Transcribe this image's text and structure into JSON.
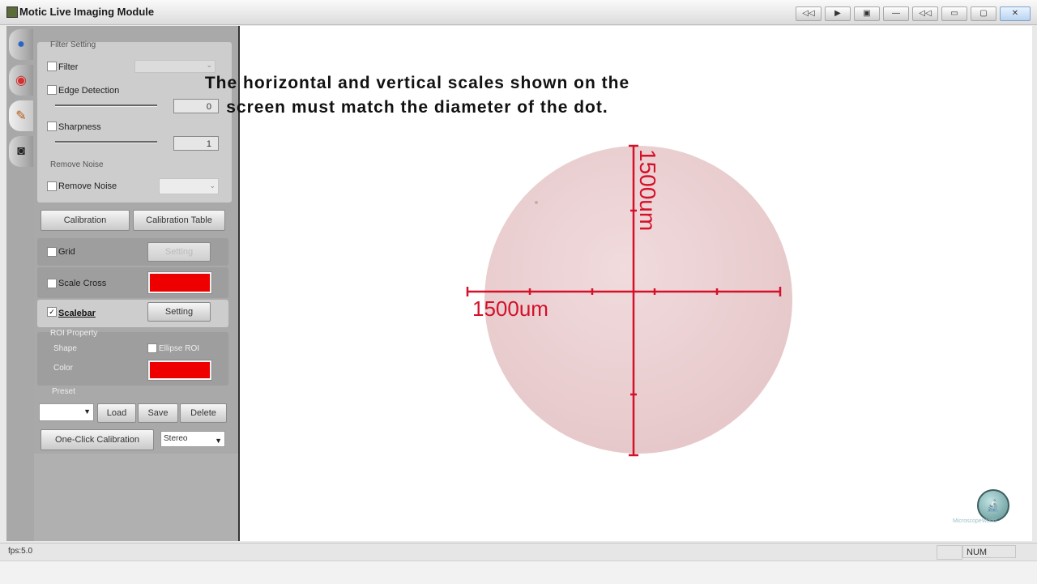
{
  "window": {
    "title": "Motic Live Imaging Module",
    "controls": {
      "c1": "◁◁",
      "c2": "▶",
      "c3": "▣",
      "c4": "—",
      "c5": "◁◁",
      "c6": "▭",
      "c7": "▢",
      "close": "✕"
    }
  },
  "toolbar": {
    "tabs": [
      {
        "icon": "capture-icon",
        "glyph": "●"
      },
      {
        "icon": "color-wheel-icon",
        "glyph": "◉"
      },
      {
        "icon": "tools-icon",
        "glyph": "✎"
      },
      {
        "icon": "camera-icon",
        "glyph": "◙"
      }
    ]
  },
  "panel": {
    "filter_setting": {
      "title": "Filter Setting",
      "filter_label": "Filter",
      "edge_detection_label": "Edge Detection",
      "edge_value": "0",
      "sharpness_label": "Sharpness",
      "sharpness_value": "1"
    },
    "remove_noise": {
      "title": "Remove Noise",
      "checkbox_label": "Remove Noise"
    },
    "calibration_button": "Calibration",
    "calibration_table_button": "Calibration Table",
    "grid": {
      "label": "Grid",
      "checked": false,
      "setting_button": "Setting"
    },
    "scale_cross": {
      "label": "Scale Cross",
      "checked": false,
      "color": "#ee0000"
    },
    "scalebar": {
      "label": "Scalebar",
      "checked": true,
      "check_mark": "✓",
      "setting_button": "Setting"
    },
    "roi_property": {
      "title": "ROI Property",
      "shape_label": "Shape",
      "ellipse_roi_label": "Ellipse ROI",
      "color_label": "Color",
      "color": "#ee0000"
    },
    "preset": {
      "title": "Preset",
      "load_button": "Load",
      "save_button": "Save",
      "delete_button": "Delete",
      "dropdown_arrow": "▼"
    },
    "one_click_calibration_button": "One-Click Calibration",
    "mode_select": {
      "value": "Stereo",
      "arrow": "▼"
    }
  },
  "viewer": {
    "caption_line1": "The horizontal and vertical scales shown on the",
    "caption_line2": "screen must match the diameter of the dot.",
    "vertical_scale_label": "1500um",
    "horizontal_scale_label": "1500um",
    "specimen_color": "#ecd2d4",
    "scale_color": "#d4102a",
    "logo_glyph": "🔬",
    "logo_text": "MicroscopeWorld"
  },
  "statusbar": {
    "fps": "fps:5.0",
    "num": "NUM"
  }
}
